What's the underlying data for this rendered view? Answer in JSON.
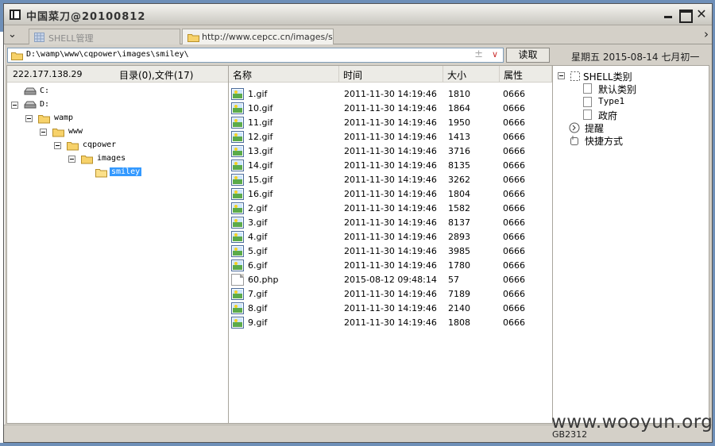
{
  "window": {
    "title": "中国菜刀@20100812"
  },
  "tabs": [
    {
      "label": "SHELL管理"
    },
    {
      "label": "http://www.cepcc.cn/images/s..."
    }
  ],
  "address": {
    "path": "D:\\wamp\\www\\cqpower\\images\\smiley\\",
    "plus_glyph": "±",
    "read_button": "读取",
    "date": "星期五 2015-08-14 七月初一"
  },
  "left": {
    "ip": "222.177.138.29",
    "summary": "目录(0),文件(17)",
    "tree": [
      {
        "label": "C:",
        "type": "drive",
        "depth": 1,
        "expander": false
      },
      {
        "label": "D:",
        "type": "drive",
        "depth": 1,
        "expander": true
      },
      {
        "label": "wamp",
        "type": "folder",
        "depth": 2,
        "expander": true
      },
      {
        "label": "www",
        "type": "folder",
        "depth": 3,
        "expander": true
      },
      {
        "label": "cqpower",
        "type": "folder",
        "depth": 4,
        "expander": true
      },
      {
        "label": "images",
        "type": "folder",
        "depth": 5,
        "expander": true
      },
      {
        "label": "smiley",
        "type": "folder-open",
        "depth": 6,
        "expander": false,
        "selected": true
      }
    ]
  },
  "files": {
    "headers": {
      "name": "名称",
      "time": "时间",
      "size": "大小",
      "attr": "属性"
    },
    "rows": [
      {
        "name": "1.gif",
        "time": "2011-11-30 14:19:46",
        "size": "1810",
        "attr": "0666",
        "type": "gif"
      },
      {
        "name": "10.gif",
        "time": "2011-11-30 14:19:46",
        "size": "1864",
        "attr": "0666",
        "type": "gif"
      },
      {
        "name": "11.gif",
        "time": "2011-11-30 14:19:46",
        "size": "1950",
        "attr": "0666",
        "type": "gif"
      },
      {
        "name": "12.gif",
        "time": "2011-11-30 14:19:46",
        "size": "1413",
        "attr": "0666",
        "type": "gif"
      },
      {
        "name": "13.gif",
        "time": "2011-11-30 14:19:46",
        "size": "3716",
        "attr": "0666",
        "type": "gif"
      },
      {
        "name": "14.gif",
        "time": "2011-11-30 14:19:46",
        "size": "8135",
        "attr": "0666",
        "type": "gif"
      },
      {
        "name": "15.gif",
        "time": "2011-11-30 14:19:46",
        "size": "3262",
        "attr": "0666",
        "type": "gif"
      },
      {
        "name": "16.gif",
        "time": "2011-11-30 14:19:46",
        "size": "1804",
        "attr": "0666",
        "type": "gif"
      },
      {
        "name": "2.gif",
        "time": "2011-11-30 14:19:46",
        "size": "1582",
        "attr": "0666",
        "type": "gif"
      },
      {
        "name": "3.gif",
        "time": "2011-11-30 14:19:46",
        "size": "8137",
        "attr": "0666",
        "type": "gif"
      },
      {
        "name": "4.gif",
        "time": "2011-11-30 14:19:46",
        "size": "2893",
        "attr": "0666",
        "type": "gif"
      },
      {
        "name": "5.gif",
        "time": "2011-11-30 14:19:46",
        "size": "3985",
        "attr": "0666",
        "type": "gif"
      },
      {
        "name": "6.gif",
        "time": "2011-11-30 14:19:46",
        "size": "1780",
        "attr": "0666",
        "type": "gif"
      },
      {
        "name": "60.php",
        "time": "2015-08-12 09:48:14",
        "size": "57",
        "attr": "0666",
        "type": "php"
      },
      {
        "name": "7.gif",
        "time": "2011-11-30 14:19:46",
        "size": "7189",
        "attr": "0666",
        "type": "gif"
      },
      {
        "name": "8.gif",
        "time": "2011-11-30 14:19:46",
        "size": "2140",
        "attr": "0666",
        "type": "gif"
      },
      {
        "name": "9.gif",
        "time": "2011-11-30 14:19:46",
        "size": "1808",
        "attr": "0666",
        "type": "gif"
      }
    ]
  },
  "right": {
    "shell_root": "SHELL类别",
    "categories": [
      "默认类别",
      "Type1",
      "政府"
    ],
    "reminder": "提醒",
    "shortcuts": "快捷方式"
  },
  "status": {
    "encoding": "GB2312"
  },
  "watermark": "www.wooyun.org"
}
